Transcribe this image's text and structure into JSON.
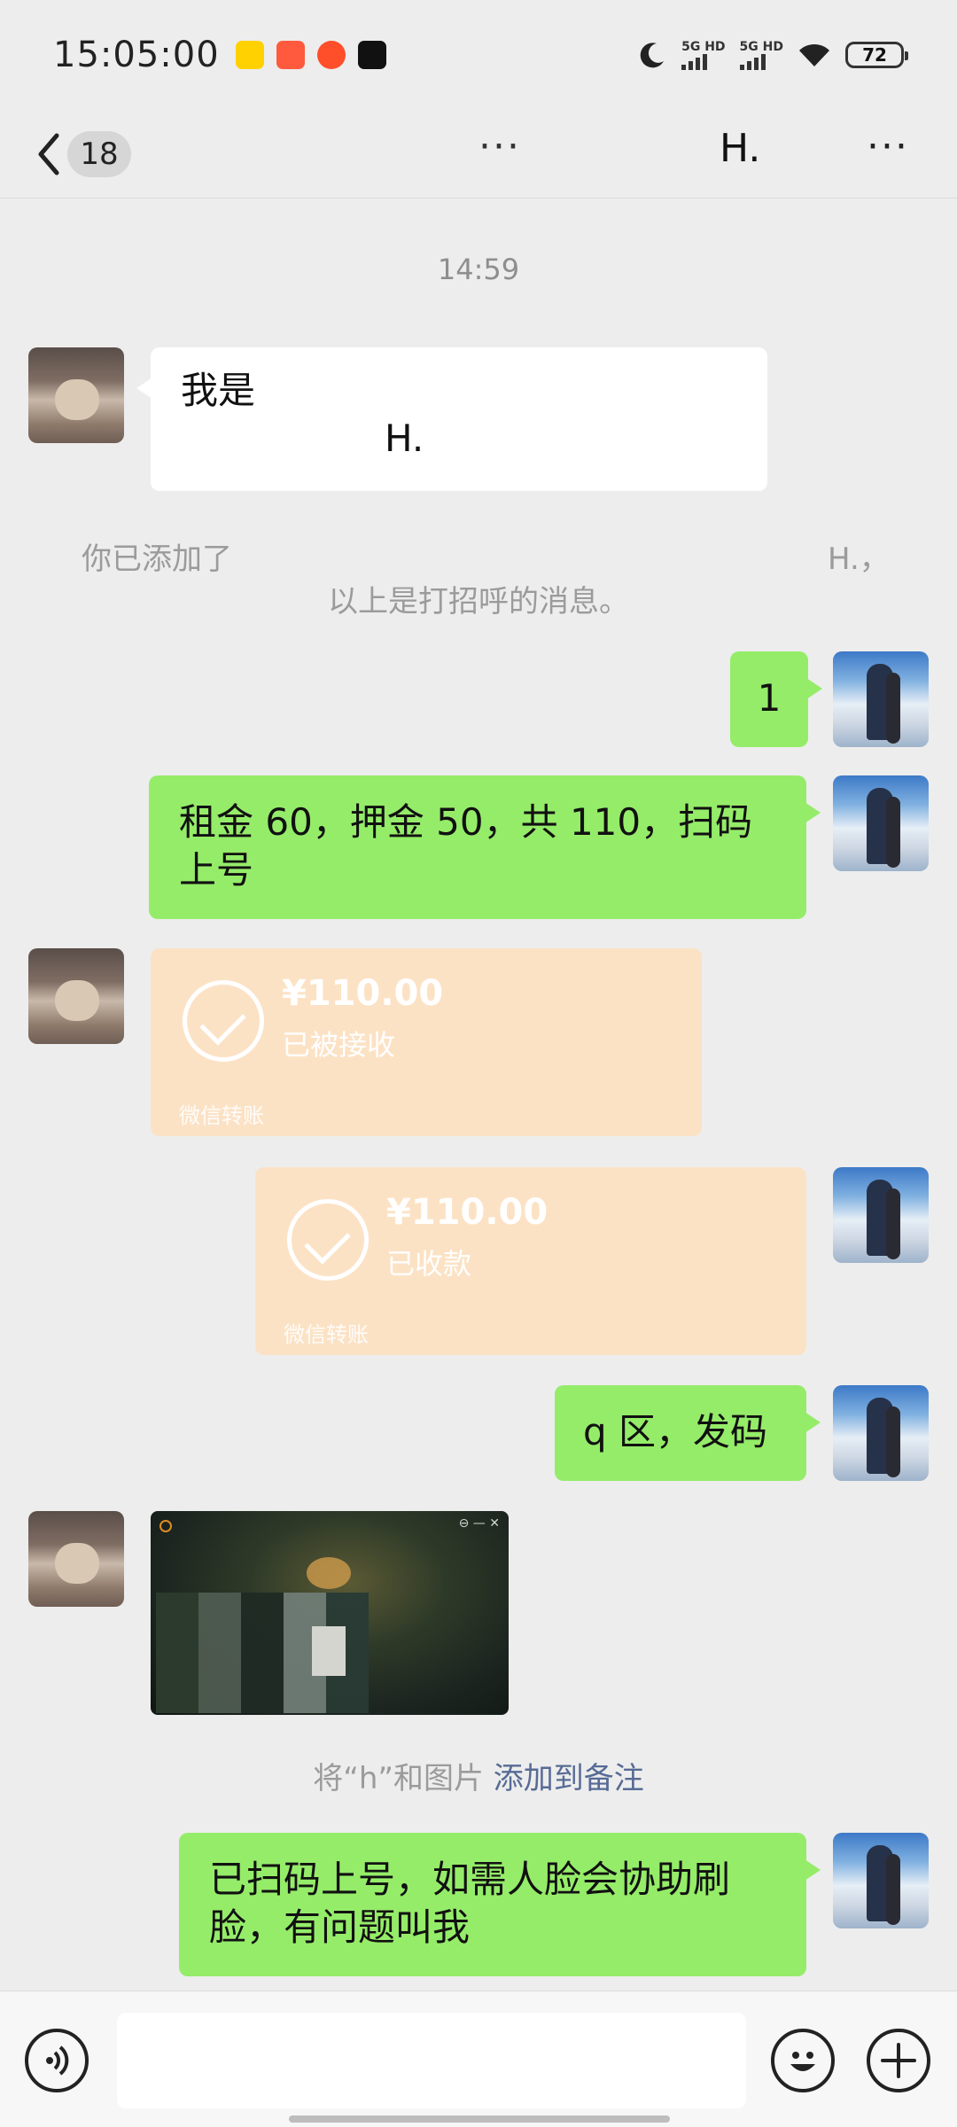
{
  "status_bar": {
    "time": "15:05:00",
    "app_icons": [
      "meituan-icon",
      "xiaohongshu-icon",
      "taobao-icon",
      "tiktok-icon"
    ],
    "signal_1": "5G HD",
    "signal_2": "5G HD",
    "battery": "72"
  },
  "nav": {
    "unread_count": "18",
    "typing_indicator": "···",
    "title": "H.",
    "more": "···"
  },
  "chat": {
    "time_divider": "14:59",
    "greeting_line1": "我是",
    "greeting_line2": "H.",
    "system_added_prefix": "你已添加了",
    "system_added_name": "H.，",
    "system_greeting_note": "以上是打招呼的消息。",
    "msg_1": "1",
    "msg_2": "租金 60，押金 50，共 110，扫码上号",
    "transfer_received": {
      "amount": "¥110.00",
      "status": "已被接收",
      "label": "微信转账"
    },
    "transfer_collected": {
      "amount": "¥110.00",
      "status": "已收款",
      "label": "微信转账"
    },
    "msg_3": "q 区，发码",
    "remark_hint": "将“h”和图片",
    "remark_link": "添加到备注",
    "msg_4": "已扫码上号，如需人脸会协助刷脸，有问题叫我"
  },
  "input_bar": {
    "voice_icon": "voice-icon",
    "emoji_icon": "emoji-icon",
    "plus_icon": "plus-icon"
  }
}
